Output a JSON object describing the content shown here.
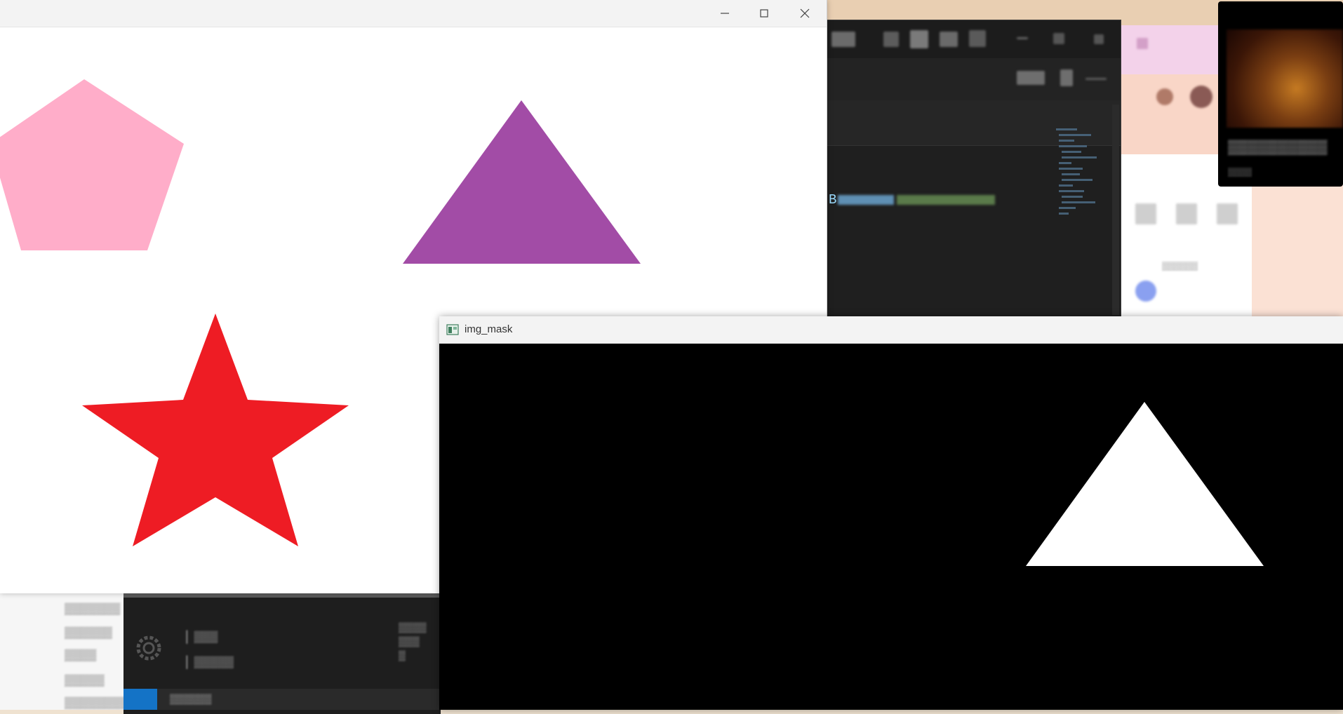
{
  "colors": {
    "pentagon": "#ffadc9",
    "triangle": "#a24ca6",
    "star": "#ee1c24",
    "mask_background": "#000000",
    "mask_triangle": "#ffffff"
  },
  "shapes_window": {
    "controls": {
      "minimize": "minimize-icon",
      "maximize": "maximize-icon",
      "close": "close-icon"
    },
    "shapes": [
      "pentagon",
      "triangle",
      "star"
    ]
  },
  "mask_window": {
    "title": "img_mask",
    "shapes": [
      "triangle"
    ]
  },
  "background_editor": {
    "code_prefix": "B"
  }
}
